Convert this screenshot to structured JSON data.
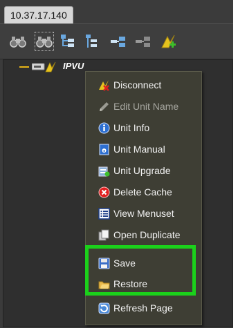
{
  "tab": {
    "label": "10.37.17.140"
  },
  "toolbar": {
    "icons": [
      "binoculars-icon",
      "binoculars-selected-icon",
      "expand-tree-icon",
      "collapse-tree-icon",
      "connect-tree-icon",
      "disconnect-tree-icon",
      "add-unit-icon"
    ]
  },
  "tree": {
    "node_label": "IPVU"
  },
  "menu": {
    "items": [
      {
        "label": "Disconnect",
        "icon": "disconnect-icon",
        "enabled": true
      },
      {
        "label": "Edit Unit Name",
        "icon": "pencil-icon",
        "enabled": false
      },
      {
        "label": "Unit Info",
        "icon": "info-icon",
        "enabled": true
      },
      {
        "label": "Unit Manual",
        "icon": "manual-icon",
        "enabled": true
      },
      {
        "label": "Unit Upgrade",
        "icon": "upgrade-icon",
        "enabled": true
      },
      {
        "label": "Delete Cache",
        "icon": "delete-icon",
        "enabled": true
      },
      {
        "label": "View Menuset",
        "icon": "list-icon",
        "enabled": true
      },
      {
        "label": "Open Duplicate",
        "icon": "duplicate-icon",
        "enabled": true
      },
      {
        "label": "Save",
        "icon": "save-icon",
        "enabled": true
      },
      {
        "label": "Restore",
        "icon": "restore-icon",
        "enabled": true
      },
      {
        "label": "Refresh Page",
        "icon": "refresh-icon",
        "enabled": true
      }
    ]
  },
  "highlight_color": "#1bd11b"
}
